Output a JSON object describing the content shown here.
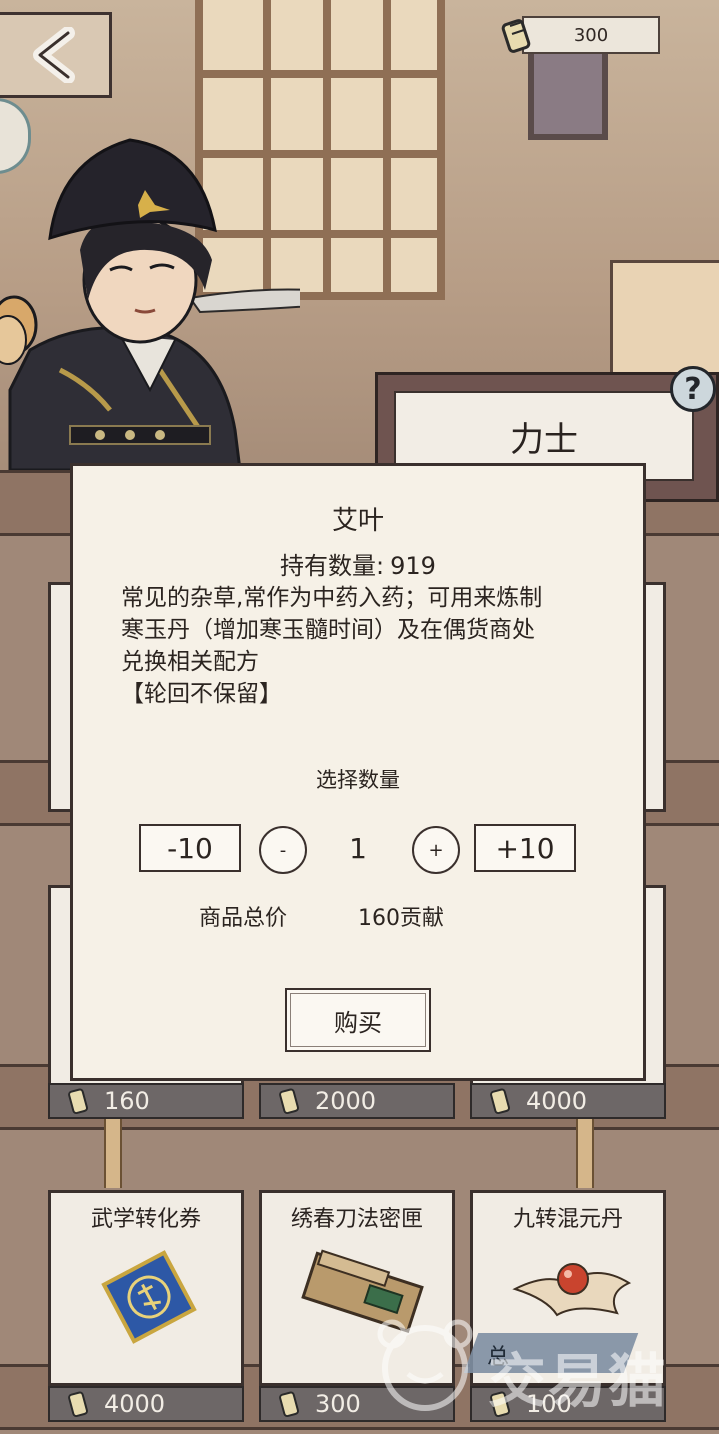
{
  "currency": {
    "amount": "300",
    "icon": "coin-scroll-icon"
  },
  "rank": {
    "label": "力士",
    "help": "?"
  },
  "dialog": {
    "item_name": "艾叶",
    "owned_label": "持有数量:",
    "owned_count": "919",
    "desc_lines": [
      "常见的杂草,常作为中药入药；可用来炼制",
      "寒玉丹（增加寒玉髓时间）及在偶货商处",
      "兑换相关配方",
      "【轮回不保留】"
    ],
    "qty_label": "选择数量",
    "minus10": "-10",
    "minus": "-",
    "quantity": "1",
    "plus": "+",
    "plus10": "+10",
    "total_label": "商品总价",
    "total_value": "160贡献",
    "buy_label": "购买"
  },
  "shop": {
    "row2_prices": [
      "160",
      "2000",
      "4000"
    ],
    "row3": [
      {
        "name": "武学转化券",
        "price": "4000"
      },
      {
        "name": "绣春刀法密匣",
        "price": "300"
      },
      {
        "name": "九转混元丹",
        "price": "100"
      }
    ],
    "partial_label": "总"
  },
  "watermark": {
    "text": "交易猫"
  }
}
